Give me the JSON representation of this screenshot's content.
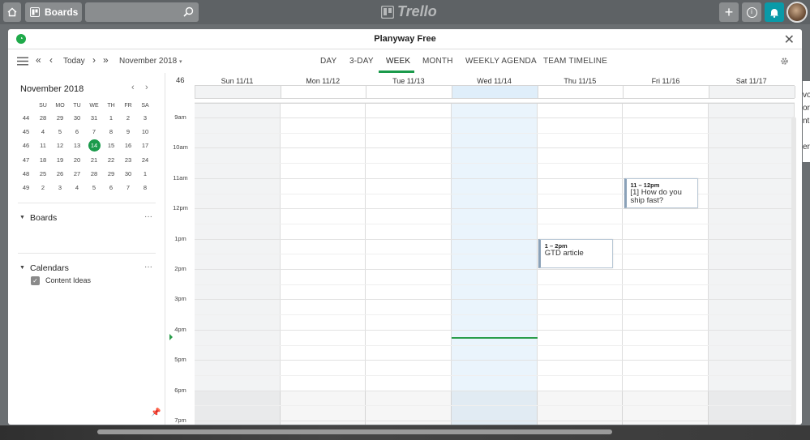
{
  "trello_bar": {
    "boards_label": "Boards",
    "brand": "Trello",
    "home_icon": "home-icon",
    "plus_label": "+",
    "info_label": "i",
    "bell_icon": "bell-icon"
  },
  "right_peek": [
    "vo",
    "oro",
    "ntu",
    "",
    "eri"
  ],
  "modal": {
    "title": "Planyway Free",
    "close_label": "✕"
  },
  "toolbar": {
    "today_label": "Today",
    "month_select": "November 2018",
    "views": [
      "DAY",
      "3-DAY",
      "WEEK",
      "MONTH",
      "WEEKLY AGENDA",
      "TEAM TIMELINE"
    ],
    "active_view": "WEEK"
  },
  "mini_calendar": {
    "title": "November 2018",
    "weekday_headers": [
      "SU",
      "MO",
      "TU",
      "WE",
      "TH",
      "FR",
      "SA"
    ],
    "weeks": [
      {
        "num": "44",
        "days": [
          "28",
          "29",
          "30",
          "31",
          "1",
          "2",
          "3"
        ]
      },
      {
        "num": "45",
        "days": [
          "4",
          "5",
          "6",
          "7",
          "8",
          "9",
          "10"
        ]
      },
      {
        "num": "46",
        "days": [
          "11",
          "12",
          "13",
          "14",
          "15",
          "16",
          "17"
        ]
      },
      {
        "num": "47",
        "days": [
          "18",
          "19",
          "20",
          "21",
          "22",
          "23",
          "24"
        ]
      },
      {
        "num": "48",
        "days": [
          "25",
          "26",
          "27",
          "28",
          "29",
          "30",
          "1"
        ]
      },
      {
        "num": "49",
        "days": [
          "2",
          "3",
          "4",
          "5",
          "6",
          "7",
          "8"
        ]
      }
    ],
    "today": "14"
  },
  "sidebar": {
    "boards_title": "Boards",
    "boards_menu": "···",
    "board_item": "Content Ideas",
    "calendars_title": "Calendars",
    "calendars_menu": "···"
  },
  "calendar": {
    "week_number": "46",
    "days": [
      "Sun 11/11",
      "Mon 11/12",
      "Tue 11/13",
      "Wed 11/14",
      "Thu 11/15",
      "Fri 11/16",
      "Sat 11/17"
    ],
    "hours": [
      "9am",
      "10am",
      "11am",
      "12pm",
      "1pm",
      "2pm",
      "3pm",
      "4pm",
      "5pm",
      "6pm",
      "7pm"
    ],
    "events": [
      {
        "time": "11 – 12pm",
        "title": "[1] How do you ship fast?",
        "day": "Fri 11/16"
      },
      {
        "time": "1 – 2pm",
        "title": "GTD article",
        "day": "Thu 11/15"
      }
    ],
    "colors": {
      "accent": "#1a9a4b",
      "today_column": "#eaf4fc",
      "weekend": "#f2f3f4"
    }
  }
}
